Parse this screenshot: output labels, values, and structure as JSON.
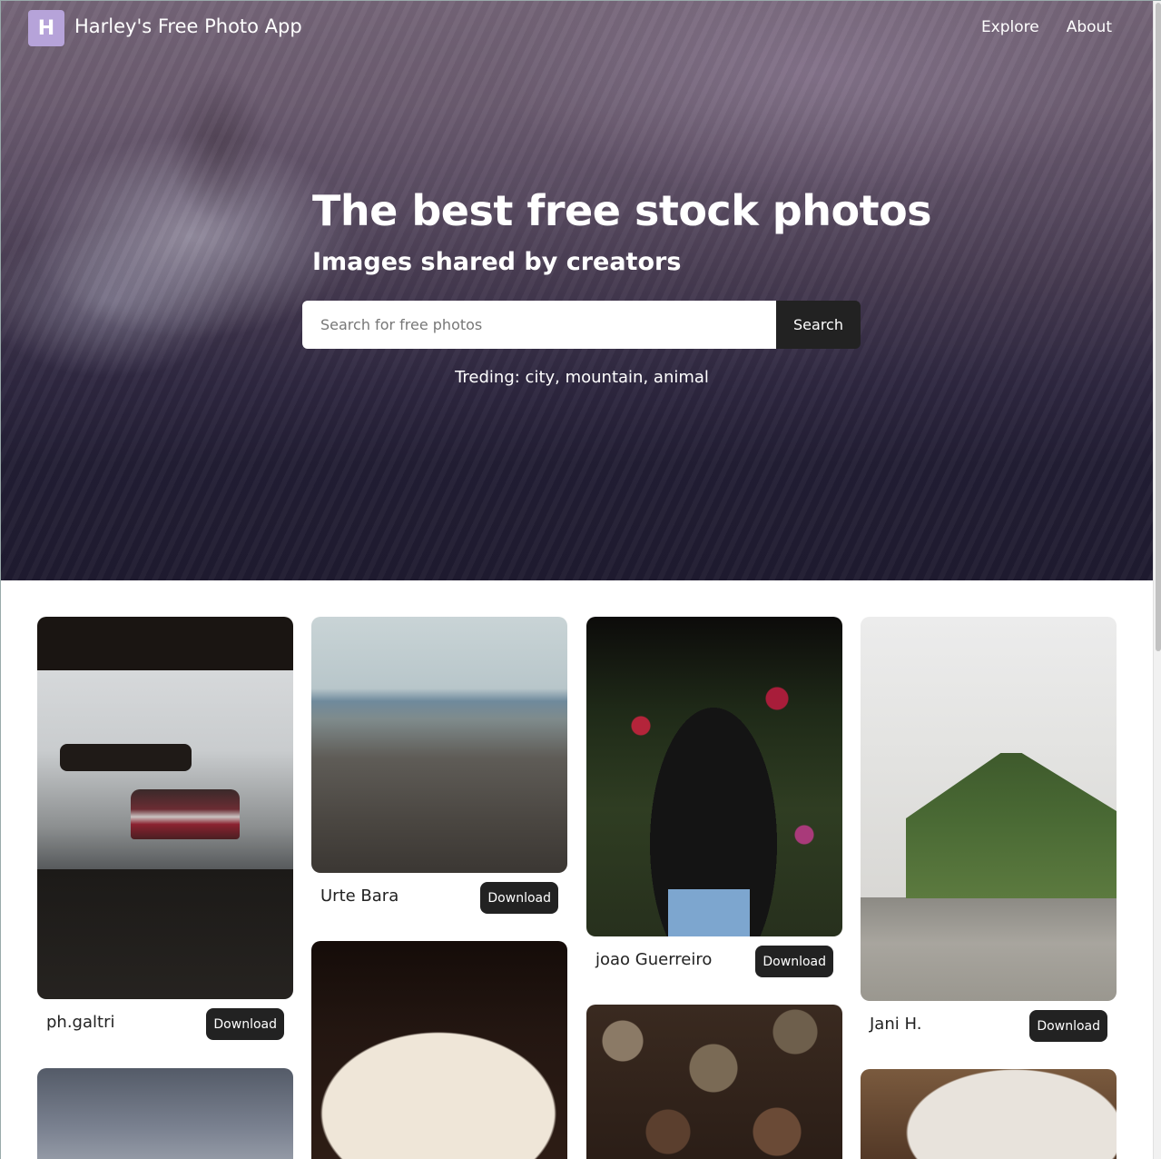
{
  "navbar": {
    "logo_letter": "H",
    "brand": "Harley's Free Photo App",
    "links": [
      "Explore",
      "About"
    ]
  },
  "hero": {
    "title": "The best free stock photos",
    "subtitle": "Images shared by creators",
    "search": {
      "placeholder": "Search for free photos",
      "value": "",
      "button_label": "Search"
    },
    "trending": "Treding: city, mountain, animal"
  },
  "gallery": {
    "download_label": "Download",
    "photos": [
      {
        "author": "ph.galtri"
      },
      {
        "author": "Urte Bara"
      },
      {
        "author": "joao Guerreiro"
      },
      {
        "author": "Jani H."
      },
      {
        "author": ""
      },
      {
        "author": ""
      },
      {
        "author": ""
      },
      {
        "author": ""
      }
    ]
  },
  "colors": {
    "logo_bg": "#b6a3d9",
    "button_bg": "#222222",
    "hero_top": "#756578",
    "hero_bottom": "#1f1b30"
  }
}
